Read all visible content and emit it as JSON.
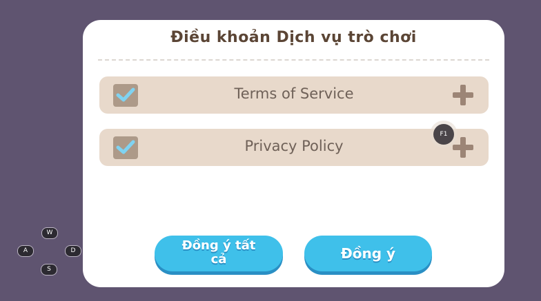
{
  "dialog": {
    "title": "Điều khoản Dịch vụ trò chơi",
    "items": [
      {
        "label": "Terms of Service",
        "checked": true
      },
      {
        "label": "Privacy Policy",
        "checked": true
      }
    ],
    "buttons": {
      "agree_all": "Đồng ý tất cả",
      "agree": "Đồng ý"
    }
  },
  "overlay": {
    "f1_marker": "F1",
    "keys": {
      "w": "W",
      "a": "A",
      "s": "S",
      "d": "D"
    }
  },
  "colors": {
    "background": "#5f5470",
    "dialog": "#ffffff",
    "row": "#e8d9cb",
    "check": "#7fd3f2",
    "button": "#3fc0ea",
    "title": "#5b4535"
  }
}
